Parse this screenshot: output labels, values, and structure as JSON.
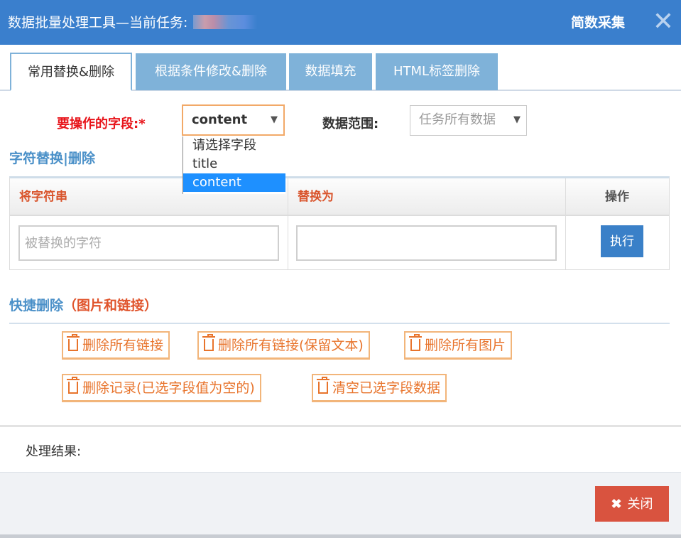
{
  "dialog": {
    "title": "数据批量处理工具—当前任务:",
    "brand": "简数采集",
    "close_glyph": "✕"
  },
  "tabs": [
    {
      "label": "常用替换&删除",
      "active": true
    },
    {
      "label": "根据条件修改&删除",
      "active": false
    },
    {
      "label": "数据填充",
      "active": false
    },
    {
      "label": "HTML标签删除",
      "active": false
    }
  ],
  "field_row": {
    "field_label": "要操作的字段:*",
    "field_value": "content",
    "field_options": [
      "请选择字段",
      "title",
      "content"
    ],
    "field_selected_option": "content",
    "range_label": "数据范围:",
    "range_value": "任务所有数据"
  },
  "replace_section": {
    "title": "字符替换|删除",
    "col_from": "将字符串",
    "col_to": "替换为",
    "col_action": "操作",
    "from_placeholder": "被替换的字符",
    "from_value": "",
    "to_value": "",
    "execute_label": "执行"
  },
  "quick_delete": {
    "title": "快捷删除",
    "title_paren": "（图片和链接）",
    "buttons": [
      {
        "label": "删除所有链接"
      },
      {
        "label": "删除所有链接(保留文本)"
      },
      {
        "label": "删除所有图片"
      },
      {
        "label": "删除记录(已选字段值为空的)"
      },
      {
        "label": "清空已选字段数据"
      }
    ]
  },
  "result": {
    "label": "处理结果:",
    "value": ""
  },
  "footer": {
    "close_label": "关闭",
    "close_glyph": "✖"
  },
  "colors": {
    "titlebar": "#3a7fcd",
    "tab_inactive": "#7fb2d9",
    "required_label": "#e8151b",
    "section_title": "#4a90c8",
    "quick_button": "#e8742c",
    "execute_button": "#3a80c8",
    "close_button": "#d9533f",
    "dropdown_highlight": "#1e90ff"
  },
  "icons": {
    "close": "close-icon",
    "dropdown_arrow": "caret-down-icon",
    "quick_button": "trash-icon"
  }
}
